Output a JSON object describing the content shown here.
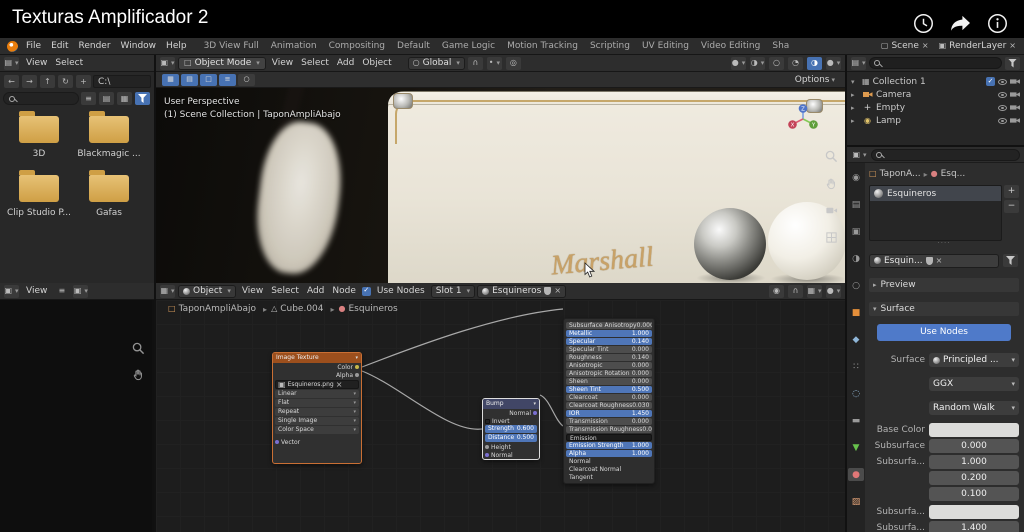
{
  "video": {
    "title": "Texturas Amplificador 2",
    "actions": [
      {
        "name": "watch-later"
      },
      {
        "name": "share"
      },
      {
        "name": "info"
      }
    ]
  },
  "menubar": {
    "menus": [
      "File",
      "Edit",
      "Render",
      "Window",
      "Help"
    ],
    "workspaces": [
      "3D View Full",
      "Animation",
      "Compositing",
      "Default",
      "Game Logic",
      "Motion Tracking",
      "Scripting",
      "UV Editing",
      "Video Editing",
      "Sha"
    ],
    "scene_name": "Scene",
    "layer_name": "RenderLayer"
  },
  "file_browser": {
    "menus": [
      "View",
      "Select"
    ],
    "path": "C:\\",
    "folders": [
      {
        "name": "3D"
      },
      {
        "name": "Blackmagic ..."
      },
      {
        "name": "Clip Studio P..."
      },
      {
        "name": "Gafas"
      }
    ]
  },
  "image_editor": {
    "menus": [
      "View"
    ]
  },
  "viewport": {
    "mode": "Object Mode",
    "menus": [
      "View",
      "Select",
      "Add",
      "Object"
    ],
    "orientation": "Global",
    "options_label": "Options",
    "overlay_line1": "User Perspective",
    "overlay_line2": "(1) Scene Collection | TaponAmpliAbajo",
    "logo_script": "Marshall",
    "gizmo": {
      "x": "X",
      "y": "Y",
      "z": "Z"
    }
  },
  "node_editor": {
    "shader_scope": "Object",
    "menus": [
      "View",
      "Select",
      "Add",
      "Node"
    ],
    "use_nodes": "Use Nodes",
    "slot": "Slot 1",
    "material_name": "Esquineros",
    "breadcrumb": [
      {
        "label": "TaponAmpliAbajo",
        "icon": "bc-obj"
      },
      {
        "label": "Cube.004",
        "icon": "bc-mesh"
      },
      {
        "label": "Esquineros",
        "icon": "bc-mat"
      }
    ],
    "image_node": {
      "title": "Image Texture",
      "outputs": [
        {
          "label": "Color",
          "socket": "s-yellow"
        },
        {
          "label": "Alpha",
          "socket": "s-gray"
        }
      ],
      "image_name": "Esquineros.png",
      "settings": [
        {
          "label": "Linear"
        },
        {
          "label": "Flat"
        },
        {
          "label": "Repeat"
        },
        {
          "label": "Single Image"
        },
        {
          "label": "Color Space"
        }
      ],
      "input_label": "Vector"
    },
    "bump_node": {
      "title": "Bump",
      "output_label": "Normal",
      "invert_label": "Invert",
      "sliders": [
        {
          "label": "Strength",
          "value": "0.600"
        },
        {
          "label": "Distance",
          "value": "0.500"
        }
      ],
      "inputs": [
        {
          "label": "Height",
          "socket": "s-gray"
        },
        {
          "label": "Normal",
          "socket": "s-purple"
        }
      ]
    },
    "principled_node": {
      "rows": [
        {
          "label": "Subsurface Anisotropy",
          "value": "0.000",
          "type": "gray"
        },
        {
          "label": "Metallic",
          "value": "1.000",
          "type": "blue"
        },
        {
          "label": "Specular",
          "value": "0.140",
          "type": "blue"
        },
        {
          "label": "Specular Tint",
          "value": "0.000",
          "type": "gray"
        },
        {
          "label": "Roughness",
          "value": "0.140",
          "type": "gray"
        },
        {
          "label": "Anisotropic",
          "value": "0.000",
          "type": "gray"
        },
        {
          "label": "Anisotropic Rotation",
          "value": "0.000",
          "type": "gray"
        },
        {
          "label": "Sheen",
          "value": "0.000",
          "type": "gray"
        },
        {
          "label": "Sheen Tint",
          "value": "0.500",
          "type": "blue"
        },
        {
          "label": "Clearcoat",
          "value": "0.000",
          "type": "gray"
        },
        {
          "label": "Clearcoat Roughness",
          "value": "0.030",
          "type": "gray"
        },
        {
          "label": "IOR",
          "value": "1.450",
          "type": "blue"
        },
        {
          "label": "Transmission",
          "value": "0.000",
          "type": "gray"
        },
        {
          "label": "Transmission Roughness",
          "value": "0.000",
          "type": "gray"
        },
        {
          "label": "Emission",
          "value": "",
          "type": "color"
        },
        {
          "label": "Emission Strength",
          "value": "1.000",
          "type": "blue"
        },
        {
          "label": "Alpha",
          "value": "1.000",
          "type": "blue"
        },
        {
          "label": "Normal",
          "value": "",
          "type": "plain"
        },
        {
          "label": "Clearcoat Normal",
          "value": "",
          "type": "plain"
        },
        {
          "label": "Tangent",
          "value": "",
          "type": "plain"
        }
      ]
    }
  },
  "outliner": {
    "collection_name": "Collection 1",
    "items": [
      {
        "name": "Camera",
        "icon": "oi-cam"
      },
      {
        "name": "Empty",
        "icon": "oi-empty"
      },
      {
        "name": "Lamp",
        "icon": "oi-lamp"
      }
    ]
  },
  "properties": {
    "tabs": [
      {
        "cls": "t-render"
      },
      {
        "cls": "t-output"
      },
      {
        "cls": "t-viewlayer"
      },
      {
        "cls": "t-scene"
      },
      {
        "cls": "t-world"
      },
      {
        "cls": "t-object"
      },
      {
        "cls": "t-modifiers"
      },
      {
        "cls": "t-particles"
      },
      {
        "cls": "t-physics"
      },
      {
        "cls": "t-constraints"
      },
      {
        "cls": "t-data"
      },
      {
        "cls": "t-material",
        "state": "active"
      },
      {
        "cls": "t-texture"
      }
    ],
    "breadcrumb_obj": "TaponA...",
    "breadcrumb_mat": "Esq...",
    "slots": [
      {
        "name": "Esquineros"
      }
    ],
    "datablock_name": "Esquin...",
    "preview_label": "Preview",
    "surface_label": "Surface",
    "use_nodes_label": "Use Nodes",
    "surface_row_label": "Surface",
    "surface_shader": "Principled ...",
    "distribution": "GGX",
    "sss_method": "Random Walk",
    "fields": [
      {
        "label": "Base Color",
        "value": "",
        "type": "swatch"
      },
      {
        "label": "Subsurface",
        "value": "0.000",
        "type": "num"
      },
      {
        "label": "Subsurfa...",
        "value": "1.000",
        "type": "num"
      },
      {
        "label": "",
        "value": "0.200",
        "type": "num"
      },
      {
        "label": "",
        "value": "0.100",
        "type": "num"
      },
      {
        "label": "Subsurfa...",
        "value": "",
        "type": "swatch",
        "gap": "gaptop"
      },
      {
        "label": "Subsurfa...",
        "value": "1.400",
        "type": "num"
      }
    ]
  }
}
